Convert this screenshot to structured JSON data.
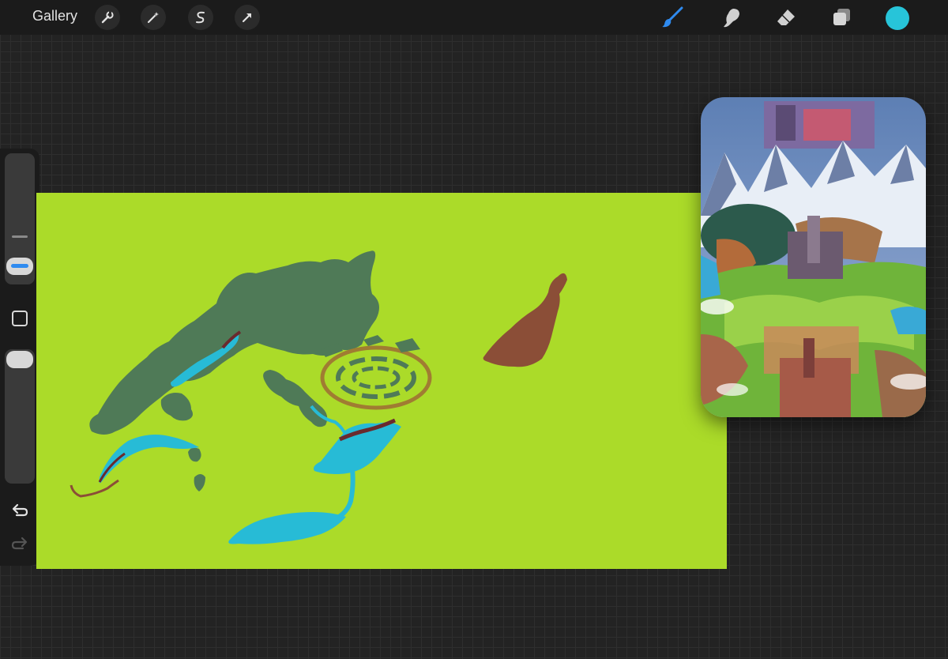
{
  "topbar": {
    "gallery_label": "Gallery",
    "left_tools": [
      "wrench-icon",
      "magic-wand-icon",
      "selection-s-icon",
      "transform-arrow-icon"
    ],
    "right_tools": [
      "brush-icon",
      "smudge-icon",
      "eraser-icon",
      "layers-icon"
    ],
    "active_tool": "brush-icon",
    "current_color": "#27c4d9"
  },
  "sidebar": {
    "controls": [
      "brush-size-slider",
      "modify-square-button",
      "opacity-slider",
      "undo-icon",
      "redo-icon"
    ]
  },
  "canvas": {
    "background_color": "#abdb29",
    "shape_colors": {
      "forest": "#4f7a57",
      "water": "#27bbd6",
      "earth": "#8b4e37",
      "ring": "#a07c32",
      "ridge": "#6a2a2e"
    }
  },
  "reference": {
    "description_icon": "reference-image"
  }
}
